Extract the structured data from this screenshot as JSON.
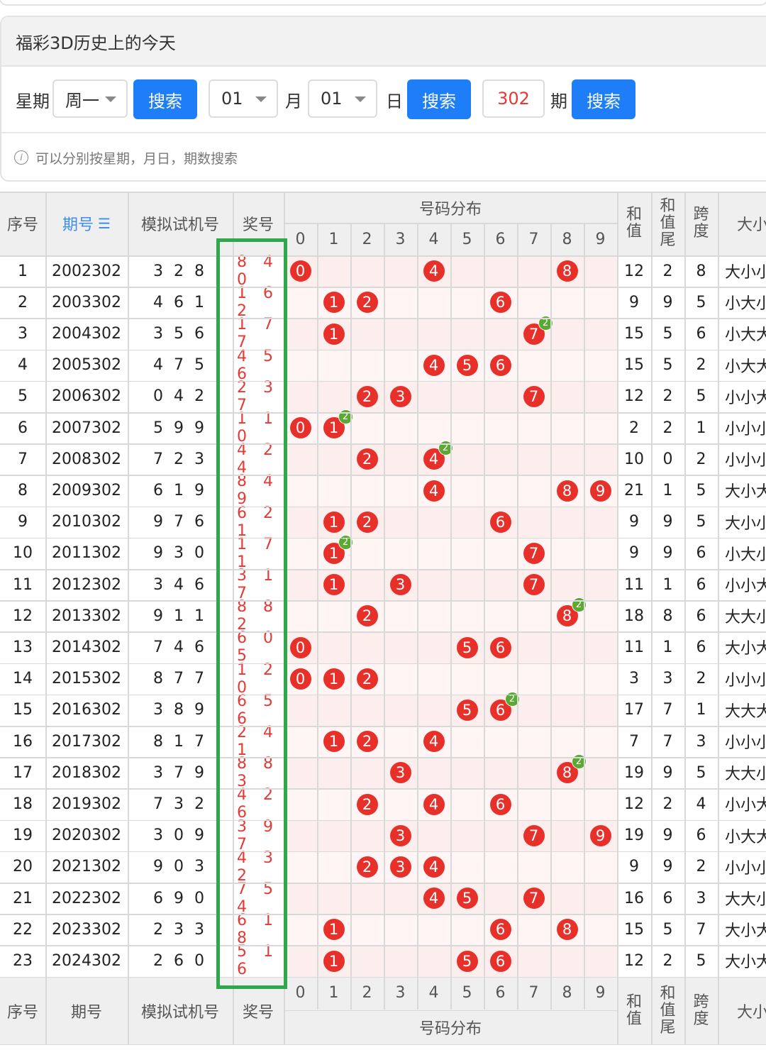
{
  "panel": {
    "title": "福彩3D历史上的今天",
    "weekday_label": "星期",
    "weekday_value": "周一",
    "search_label": "搜索",
    "month_value": "01",
    "month_label": "月",
    "day_value": "01",
    "day_label": "日",
    "issue_value": "302",
    "issue_label": "期",
    "hint_icon": "i",
    "hint": "可以分别按星期，月日，期数搜索"
  },
  "table": {
    "headers": {
      "seq": "序号",
      "issue": "期号",
      "sort_icon": "sort-icon",
      "sim": "模拟试机号",
      "prize": "奖号",
      "dist": "号码分布",
      "sum": "和值",
      "sum_tail": "和值尾",
      "span": "跨度",
      "size": "大小"
    },
    "digits": [
      "0",
      "1",
      "2",
      "3",
      "4",
      "5",
      "6",
      "7",
      "8",
      "9"
    ],
    "rows": [
      {
        "seq": "1",
        "issue": "2002302",
        "sim": "3 2 8",
        "prize": "8 4 0",
        "sum": "12",
        "tail": "2",
        "span": "8",
        "size": "大小小"
      },
      {
        "seq": "2",
        "issue": "2003302",
        "sim": "4 6 1",
        "prize": "1 6 2",
        "sum": "9",
        "tail": "9",
        "span": "5",
        "size": "小大小"
      },
      {
        "seq": "3",
        "issue": "2004302",
        "sim": "3 5 6",
        "prize": "1 7 7",
        "sum": "15",
        "tail": "5",
        "span": "6",
        "size": "小大大"
      },
      {
        "seq": "4",
        "issue": "2005302",
        "sim": "4 7 5",
        "prize": "4 5 6",
        "sum": "15",
        "tail": "5",
        "span": "2",
        "size": "小大大"
      },
      {
        "seq": "5",
        "issue": "2006302",
        "sim": "0 4 2",
        "prize": "2 3 7",
        "sum": "12",
        "tail": "2",
        "span": "5",
        "size": "小小大"
      },
      {
        "seq": "6",
        "issue": "2007302",
        "sim": "5 9 9",
        "prize": "1 1 0",
        "sum": "2",
        "tail": "2",
        "span": "1",
        "size": "小小小"
      },
      {
        "seq": "7",
        "issue": "2008302",
        "sim": "7 2 3",
        "prize": "4 2 4",
        "sum": "10",
        "tail": "0",
        "span": "2",
        "size": "小小小"
      },
      {
        "seq": "8",
        "issue": "2009302",
        "sim": "6 1 9",
        "prize": "8 4 9",
        "sum": "21",
        "tail": "1",
        "span": "5",
        "size": "大小大"
      },
      {
        "seq": "9",
        "issue": "2010302",
        "sim": "9 7 6",
        "prize": "6 2 1",
        "sum": "9",
        "tail": "9",
        "span": "5",
        "size": "大小小"
      },
      {
        "seq": "10",
        "issue": "2011302",
        "sim": "9 3 0",
        "prize": "1 7 1",
        "sum": "9",
        "tail": "9",
        "span": "6",
        "size": "小大小"
      },
      {
        "seq": "11",
        "issue": "2012302",
        "sim": "3 4 6",
        "prize": "3 1 7",
        "sum": "11",
        "tail": "1",
        "span": "6",
        "size": "小小大"
      },
      {
        "seq": "12",
        "issue": "2013302",
        "sim": "9 1 1",
        "prize": "8 8 2",
        "sum": "18",
        "tail": "8",
        "span": "6",
        "size": "大大小"
      },
      {
        "seq": "13",
        "issue": "2014302",
        "sim": "7 4 6",
        "prize": "6 0 5",
        "sum": "11",
        "tail": "1",
        "span": "6",
        "size": "大小大"
      },
      {
        "seq": "14",
        "issue": "2015302",
        "sim": "8 7 7",
        "prize": "1 2 0",
        "sum": "3",
        "tail": "3",
        "span": "2",
        "size": "小小小"
      },
      {
        "seq": "15",
        "issue": "2016302",
        "sim": "3 8 9",
        "prize": "6 5 6",
        "sum": "17",
        "tail": "7",
        "span": "1",
        "size": "大大大"
      },
      {
        "seq": "16",
        "issue": "2017302",
        "sim": "8 1 7",
        "prize": "2 4 1",
        "sum": "7",
        "tail": "7",
        "span": "3",
        "size": "小小小"
      },
      {
        "seq": "17",
        "issue": "2018302",
        "sim": "3 7 9",
        "prize": "8 8 3",
        "sum": "19",
        "tail": "9",
        "span": "5",
        "size": "大大小"
      },
      {
        "seq": "18",
        "issue": "2019302",
        "sim": "7 3 2",
        "prize": "4 2 6",
        "sum": "12",
        "tail": "2",
        "span": "4",
        "size": "小小大"
      },
      {
        "seq": "19",
        "issue": "2020302",
        "sim": "3 0 9",
        "prize": "3 9 7",
        "sum": "19",
        "tail": "9",
        "span": "6",
        "size": "小大大"
      },
      {
        "seq": "20",
        "issue": "2021302",
        "sim": "9 0 3",
        "prize": "4 3 2",
        "sum": "9",
        "tail": "9",
        "span": "2",
        "size": "小小小"
      },
      {
        "seq": "21",
        "issue": "2022302",
        "sim": "6 9 0",
        "prize": "7 5 4",
        "sum": "16",
        "tail": "6",
        "span": "3",
        "size": "大大小"
      },
      {
        "seq": "22",
        "issue": "2023302",
        "sim": "2 3 3",
        "prize": "6 1 8",
        "sum": "15",
        "tail": "5",
        "span": "7",
        "size": "大小大"
      },
      {
        "seq": "23",
        "issue": "2024302",
        "sim": "2 6 0",
        "prize": "5 1 6",
        "sum": "12",
        "tail": "2",
        "span": "5",
        "size": "大小大"
      }
    ]
  },
  "colors": {
    "accent": "#1e7ef7",
    "ball": "#e8302b",
    "repeat_badge": "#5ba832",
    "highlight_box": "#2ea84a",
    "prize_text": "#e53935"
  }
}
